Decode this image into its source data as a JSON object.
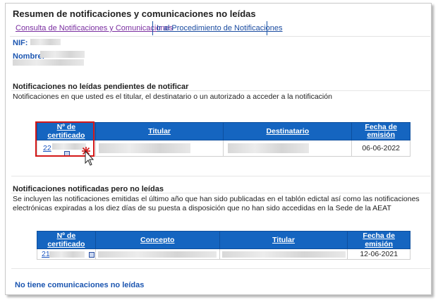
{
  "page": {
    "title": "Resumen de notificaciones y comunicaciones no leídas"
  },
  "tabs": [
    {
      "label": "Consulta de Notificaciones y Comunicaciones"
    },
    {
      "label": "Ir al Procedimiento de Notificaciones"
    }
  ],
  "fields": {
    "nif_label": "NIF:",
    "nombre_label": "Nombre:"
  },
  "pending": {
    "title": "Notificaciones no leídas pendientes de notificar",
    "description": "Notificaciones en que usted es el titular, el destinatario o un autorizado a acceder a la notificación",
    "columns": [
      "Nº de certificado",
      "Titular",
      "Destinatario",
      "Fecha de emisión"
    ],
    "rows": [
      {
        "certificado": "22",
        "fecha": "06-06-2022"
      }
    ]
  },
  "notified": {
    "title": "Notificaciones notificadas pero no leídas",
    "description": "Se incluyen las notificaciones emitidas el último año que han sido publicadas en el tablón edictal así como las notificaciones electrónicas expiradas a los diez días de su puesta a disposición que no han sido accedidas en la Sede de la AEAT",
    "columns": [
      "Nº de certificado",
      "Concepto",
      "Titular",
      "Fecha de emisión"
    ],
    "rows": [
      {
        "certificado": "21",
        "fecha": "12-06-2021"
      }
    ]
  },
  "footer": {
    "message": "No tiene comunicaciones no leídas"
  },
  "colors": {
    "header_blue": "#1565c0",
    "label_blue": "#1b55b0",
    "highlight_red": "#d41818"
  },
  "icons": [
    "document-link-icon",
    "mouse-pointer-icon",
    "click-burst-icon"
  ]
}
